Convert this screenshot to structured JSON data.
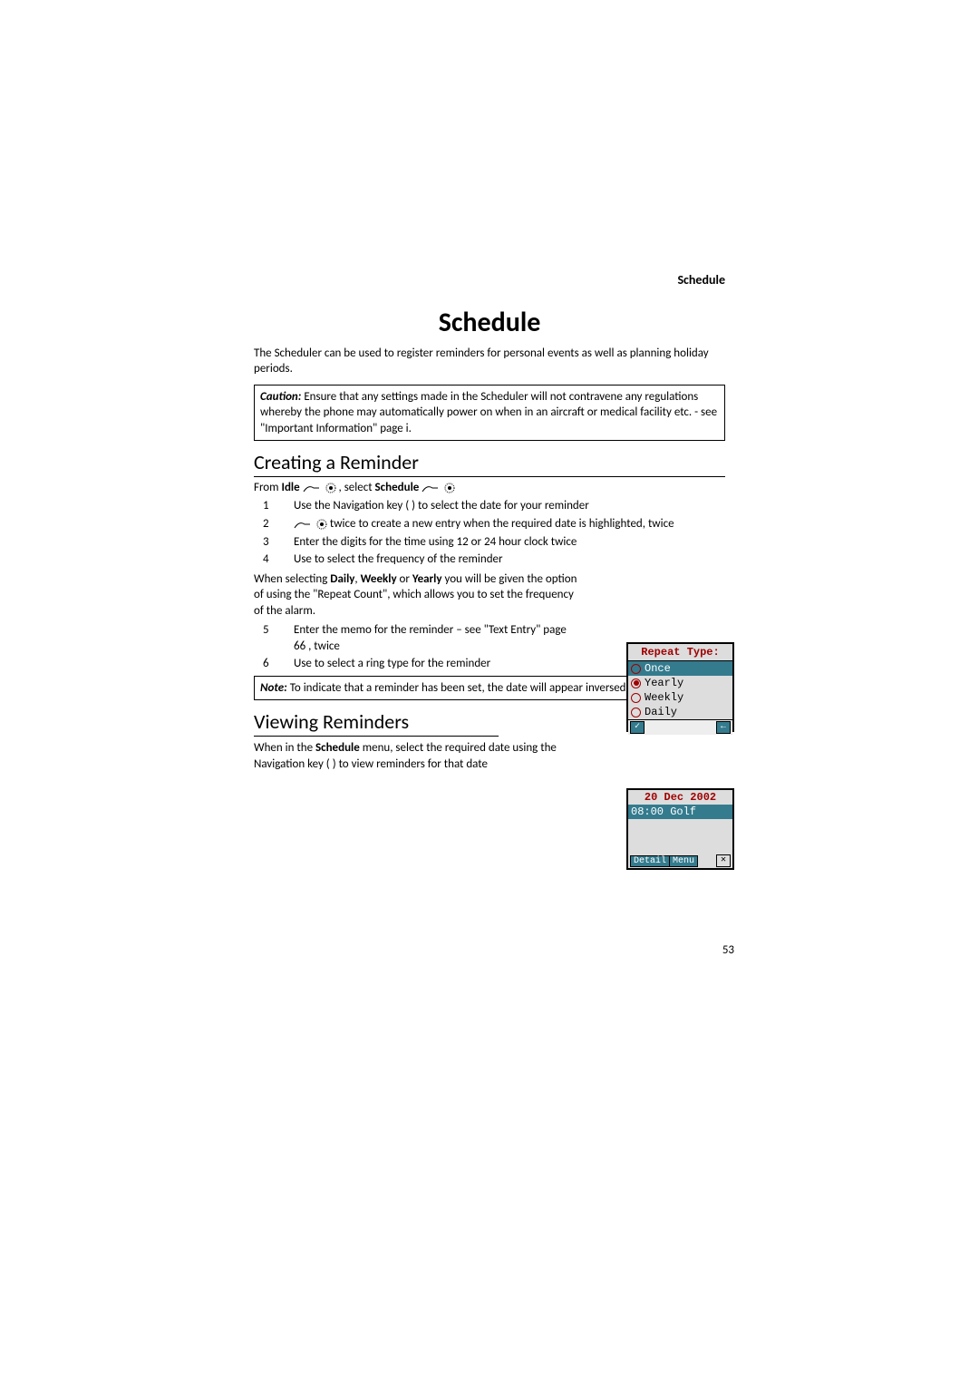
{
  "header": {
    "section": "Schedule"
  },
  "title": "Schedule",
  "intro": "The Scheduler can be used to register reminders for personal events as well as planning holiday periods.",
  "caution": {
    "label": "Caution:",
    "text": "Ensure that any settings made in the Scheduler will not contravene any regulations whereby the phone may automatically power on when in an aircraft or medical facility etc. - see \"Important Information\" page i."
  },
  "creating": {
    "heading": "Creating a Reminder",
    "from_prefix": "From ",
    "from_idle": "Idle",
    "from_mid": " , select ",
    "from_schedule": "Schedule",
    "steps": [
      {
        "n": "1",
        "text": "Use the Navigation key ( ) to select the date for your reminder"
      },
      {
        "n": "2",
        "text": " twice to create a new entry when the required date is highlighted,  twice"
      },
      {
        "n": "3",
        "text": "Enter the digits for the time using 12 or 24 hour clock  twice"
      },
      {
        "n": "4",
        "text": "Use  to select the frequency of the reminder "
      }
    ],
    "repeat_para_prefix": "When selecting ",
    "repeat_daily": "Daily",
    "repeat_weekly": "Weekly",
    "repeat_yearly": "Yearly",
    "repeat_para_suffix": " you will be given the option of using the \"Repeat Count\", which allows you to set the frequency of the alarm.",
    "steps2": [
      {
        "n": "5",
        "text": "Enter the memo for the reminder – see \"Text Entry\" page 66 ,  twice"
      },
      {
        "n": "6",
        "text": "Use  to select a ring type for the reminder "
      }
    ]
  },
  "note": {
    "label": "Note:",
    "text": "To indicate that a reminder has been set, the date will appear inversed."
  },
  "viewing": {
    "heading": "Viewing Reminders",
    "para_prefix": "When in the ",
    "para_schedule": "Schedule",
    "para_suffix": " menu, select the required date using the Navigation key ( )  to view reminders for that date"
  },
  "screen1": {
    "header": "Repeat Type:",
    "options": [
      "Once",
      "Yearly",
      "Weekly",
      "Daily"
    ],
    "selected_index": 0,
    "highlighted_index": 1,
    "ok_glyph": "✓",
    "back_glyph": "←"
  },
  "screen2": {
    "date": "20 Dec 2002",
    "entry": "08:00 Golf",
    "detail": "Detail",
    "menu": "Menu",
    "close_glyph": "✕"
  },
  "page_number": "53"
}
